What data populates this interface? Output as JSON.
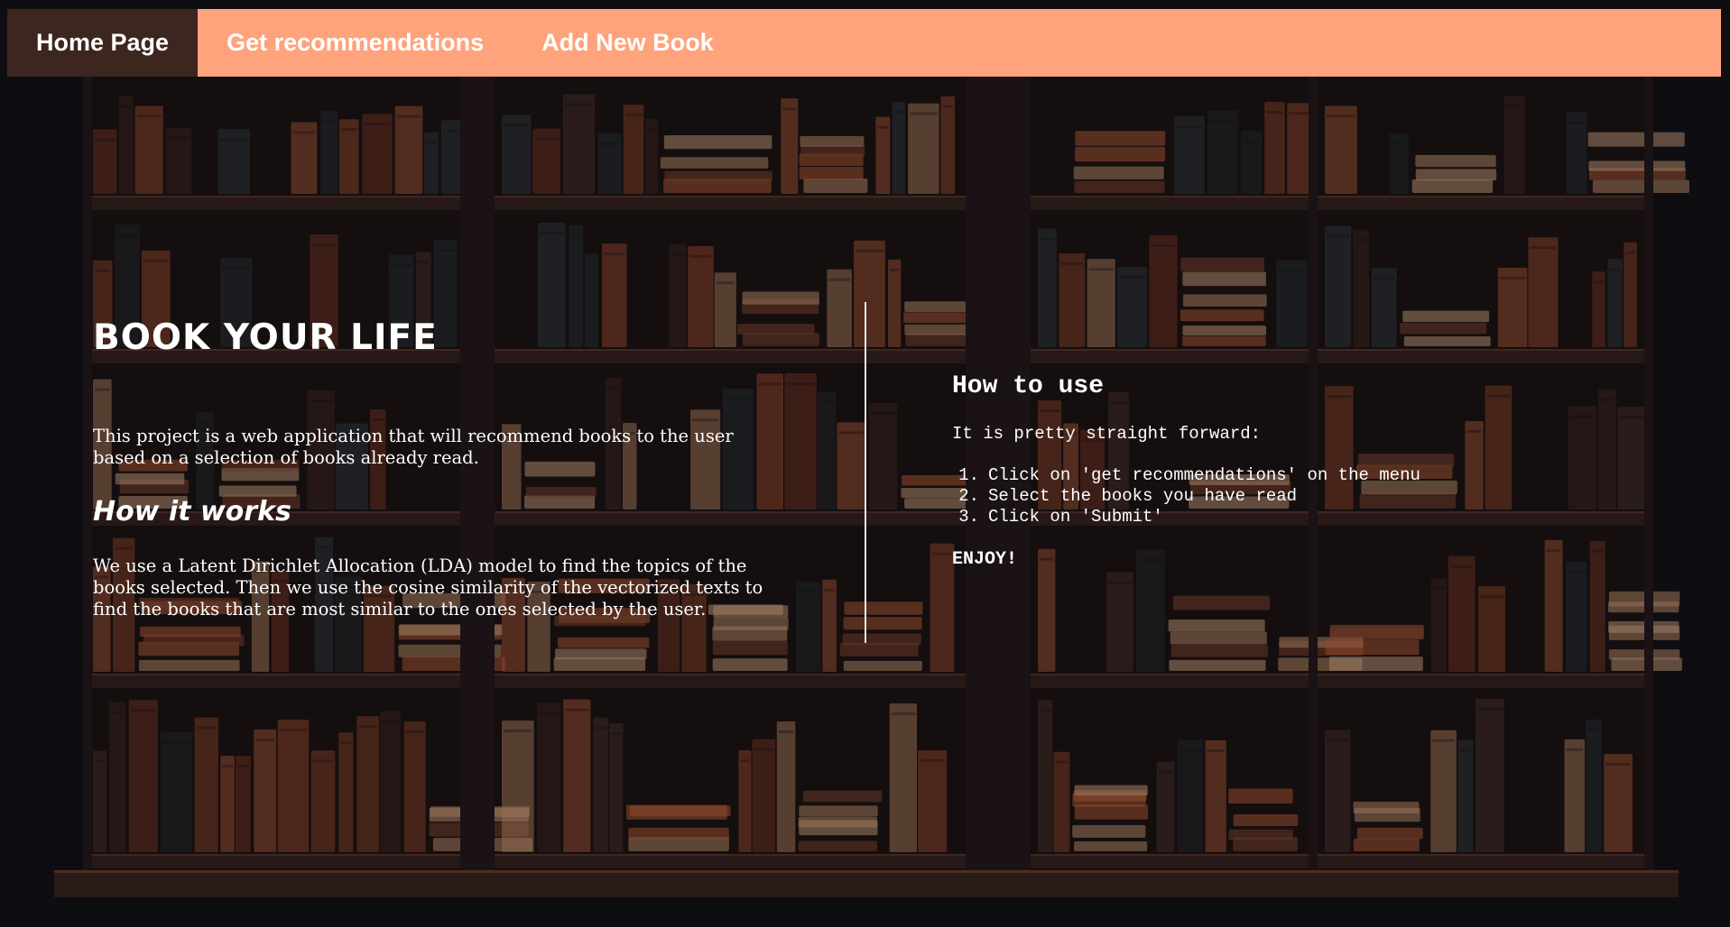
{
  "nav": {
    "items": [
      {
        "label": "Home Page",
        "active": true
      },
      {
        "label": "Get recommendations",
        "active": false
      },
      {
        "label": "Add New Book",
        "active": false
      }
    ],
    "bar_color": "#ffa37d",
    "active_color": "#3d2520"
  },
  "left": {
    "title": "BOOK YOUR LIFE",
    "intro": "This project is a web application that will recommend books to the user based on a selection of books already read.",
    "how_it_works_heading": "How it works",
    "how_it_works_text": "We use a Latent Dirichlet Allocation (LDA) model to find the topics of the books selected. Then we use the cosine similarity of the vectorized texts to find the books that are most similar to the ones selected by the user."
  },
  "right": {
    "heading": "How to use",
    "intro": "It is pretty straight forward:",
    "steps": [
      "Click on 'get recommendations' on the menu",
      "Select the books you have read",
      "Click on 'Submit'"
    ],
    "step_numbers": [
      "1.",
      "2.",
      "3."
    ],
    "closing": "ENJOY!"
  },
  "background": {
    "image": "bookshelf-illustration",
    "accent_colors": [
      "#c0603e",
      "#2e3a40",
      "#d9a27c",
      "#3a1f1a"
    ]
  }
}
